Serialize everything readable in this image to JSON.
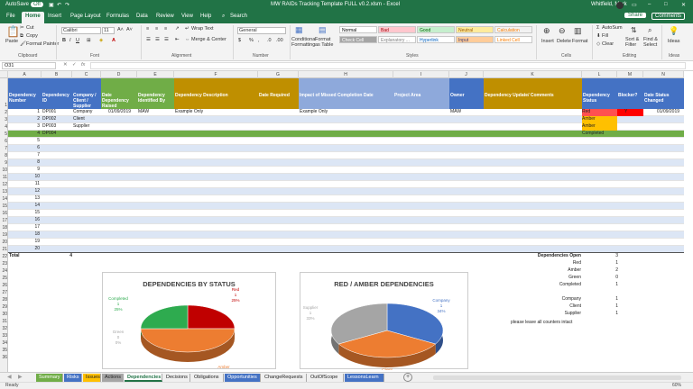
{
  "titlebar": {
    "autosave": "AutoSave",
    "autosave_state": "Off",
    "filename": "MW RAIDs Tracking Template FULL v0.2.xlsm - Excel",
    "user": "Whitfield, Mark"
  },
  "ribbon_tabs": [
    "File",
    "Home",
    "Insert",
    "Page Layout",
    "Formulas",
    "Data",
    "Review",
    "View",
    "Help"
  ],
  "search_label": "Search",
  "share_label": "Share",
  "comments_label": "Comments",
  "clipboard": {
    "paste": "Paste",
    "cut": "Cut",
    "copy": "Copy",
    "format_painter": "Format Painter",
    "group": "Clipboard"
  },
  "font": {
    "name": "Calibri",
    "size": "11",
    "group": "Font"
  },
  "alignment": {
    "wrap": "Wrap Text",
    "merge": "Merge & Center",
    "group": "Alignment"
  },
  "number": {
    "format": "General",
    "group": "Number"
  },
  "styles": {
    "cond": "Conditional Formatting",
    "table": "Format as Table",
    "group": "Styles",
    "items": [
      {
        "label": "Normal",
        "bg": "#ffffff",
        "fg": "#000000"
      },
      {
        "label": "Bad",
        "bg": "#ffc7ce",
        "fg": "#9c0006"
      },
      {
        "label": "Good",
        "bg": "#c6efce",
        "fg": "#006100"
      },
      {
        "label": "Neutral",
        "bg": "#ffeb9c",
        "fg": "#9c5700"
      },
      {
        "label": "Calculation",
        "bg": "#f2f2f2",
        "fg": "#fa7d00"
      },
      {
        "label": "Check Cell",
        "bg": "#a5a5a5",
        "fg": "#ffffff"
      },
      {
        "label": "Explanatory ...",
        "bg": "#ffffff",
        "fg": "#7f7f7f"
      },
      {
        "label": "Hyperlink",
        "bg": "#ffffff",
        "fg": "#0563c1"
      },
      {
        "label": "Input",
        "bg": "#ffcc99",
        "fg": "#3f3f76"
      },
      {
        "label": "Linked Cell",
        "bg": "#ffffff",
        "fg": "#fa7d00"
      }
    ]
  },
  "cells_group": {
    "insert": "Insert",
    "delete": "Delete",
    "format": "Format",
    "group": "Cells"
  },
  "editing": {
    "autosum": "AutoSum",
    "fill": "Fill",
    "clear": "Clear",
    "sort": "Sort & Filter",
    "find": "Find & Select",
    "group": "Editing"
  },
  "ideas": {
    "label": "Ideas",
    "group": "Ideas"
  },
  "namebox": "O31",
  "fx": "fx",
  "columns": [
    "A",
    "B",
    "C",
    "D",
    "E",
    "F",
    "G",
    "H",
    "I",
    "J",
    "K",
    "L",
    "M",
    "N"
  ],
  "headers": [
    {
      "text": "Dependency Number",
      "bg": "#4472c4"
    },
    {
      "text": "Dependency ID",
      "bg": "#4472c4"
    },
    {
      "text": "Company / Client / Supplier",
      "bg": "#4472c4"
    },
    {
      "text": "Date Dependency Raised",
      "bg": "#70ad47"
    },
    {
      "text": "Dependency Identified By",
      "bg": "#70ad47"
    },
    {
      "text": "Dependency Description",
      "bg": "#bf8f00"
    },
    {
      "text": "Date Required",
      "bg": "#bf8f00"
    },
    {
      "text": "Impact of Missed Completion Date",
      "bg": "#8ea9db"
    },
    {
      "text": "Project Area",
      "bg": "#8ea9db"
    },
    {
      "text": "Owner",
      "bg": "#4472c4"
    },
    {
      "text": "Dependency Update/ Comments",
      "bg": "#bf8f00"
    },
    {
      "text": "Dependency Status",
      "bg": "#4472c4"
    },
    {
      "text": "Blocker?",
      "bg": "#4472c4"
    },
    {
      "text": "Date Status Changed",
      "bg": "#4472c4"
    }
  ],
  "rows": [
    {
      "num": "1",
      "id": "DP001",
      "company": "Company",
      "date": "01/09/2019",
      "by": "MAW",
      "desc": "Example Only",
      "impact": "Example Only",
      "owner": "MAW",
      "status": "Red",
      "blocker": "Y",
      "changed": "01/09/2019"
    },
    {
      "num": "2",
      "id": "DP002",
      "company": "Client",
      "status": "Amber"
    },
    {
      "num": "3",
      "id": "DP003",
      "company": "Supplier",
      "status": "Amber"
    },
    {
      "num": "4",
      "id": "DP004",
      "status": "Completed"
    },
    {
      "num": "5"
    },
    {
      "num": "6"
    },
    {
      "num": "7"
    },
    {
      "num": "8"
    },
    {
      "num": "9"
    },
    {
      "num": "10"
    },
    {
      "num": "11"
    },
    {
      "num": "12"
    },
    {
      "num": "13"
    },
    {
      "num": "14"
    },
    {
      "num": "15"
    },
    {
      "num": "16"
    },
    {
      "num": "17"
    },
    {
      "num": "18"
    },
    {
      "num": "19"
    },
    {
      "num": "20"
    }
  ],
  "row_numbers": [
    "1",
    "2",
    "3",
    "4",
    "5",
    "6",
    "7",
    "8",
    "9",
    "10",
    "11",
    "12",
    "13",
    "14",
    "15",
    "16",
    "17",
    "18",
    "19",
    "20",
    "21",
    "22",
    "23",
    "24",
    "25",
    "26",
    "27",
    "28",
    "29",
    "30",
    "31",
    "32",
    "33",
    "34",
    "35",
    "36"
  ],
  "total_label": "Total",
  "total_value": "4",
  "summary": [
    {
      "label": "Dependencies Open",
      "value": "3"
    },
    {
      "label": "Red",
      "value": "1"
    },
    {
      "label": "Amber",
      "value": "2"
    },
    {
      "label": "Green",
      "value": "0"
    },
    {
      "label": "Completed",
      "value": "1"
    },
    {
      "label": "",
      "value": ""
    },
    {
      "label": "Company",
      "value": "1"
    },
    {
      "label": "Client",
      "value": "1"
    },
    {
      "label": "Supplier",
      "value": "1"
    }
  ],
  "note": "please leave all counters intact",
  "chart_data": [
    {
      "type": "pie",
      "title": "DEPENDENCIES BY STATUS",
      "categories": [
        "Red",
        "Amber",
        "Green",
        "Completed"
      ],
      "values": [
        1,
        2,
        0,
        1
      ],
      "percents": [
        "25%",
        "50%",
        "0%",
        "25%"
      ],
      "colors": [
        "#c00000",
        "#ed7d31",
        "#a5a5a5",
        "#2eab4f"
      ]
    },
    {
      "type": "pie",
      "title": "RED / AMBER DEPENDENCIES",
      "categories": [
        "Company",
        "Client",
        "Supplier"
      ],
      "values": [
        1,
        1,
        1
      ],
      "percents": [
        "34%",
        "33%",
        "33%"
      ],
      "colors": [
        "#4472c4",
        "#ed7d31",
        "#a5a5a5"
      ]
    }
  ],
  "sheet_tabs": [
    {
      "label": "Summary",
      "bg": "#70ad47",
      "fg": "#fff"
    },
    {
      "label": "Risks",
      "bg": "#4472c4",
      "fg": "#fff"
    },
    {
      "label": "Issues",
      "bg": "#ffc000",
      "fg": "#222"
    },
    {
      "label": "Actions",
      "bg": "#a5a5a5",
      "fg": "#222"
    },
    {
      "label": "Dependencies",
      "bg": "#ffffff",
      "fg": "#217346"
    },
    {
      "label": "Decisions",
      "bg": "#f0f0f0",
      "fg": "#222"
    },
    {
      "label": "Obligations",
      "bg": "#f0f0f0",
      "fg": "#222"
    },
    {
      "label": "Opportunities",
      "bg": "#4472c4",
      "fg": "#fff"
    },
    {
      "label": "ChangeRequests",
      "bg": "#f0f0f0",
      "fg": "#222"
    },
    {
      "label": "OutOfScope",
      "bg": "#f0f0f0",
      "fg": "#222"
    },
    {
      "label": "LessonsLearn",
      "bg": "#4472c4",
      "fg": "#fff"
    }
  ],
  "status": {
    "ready": "Ready",
    "zoom": "60%"
  }
}
